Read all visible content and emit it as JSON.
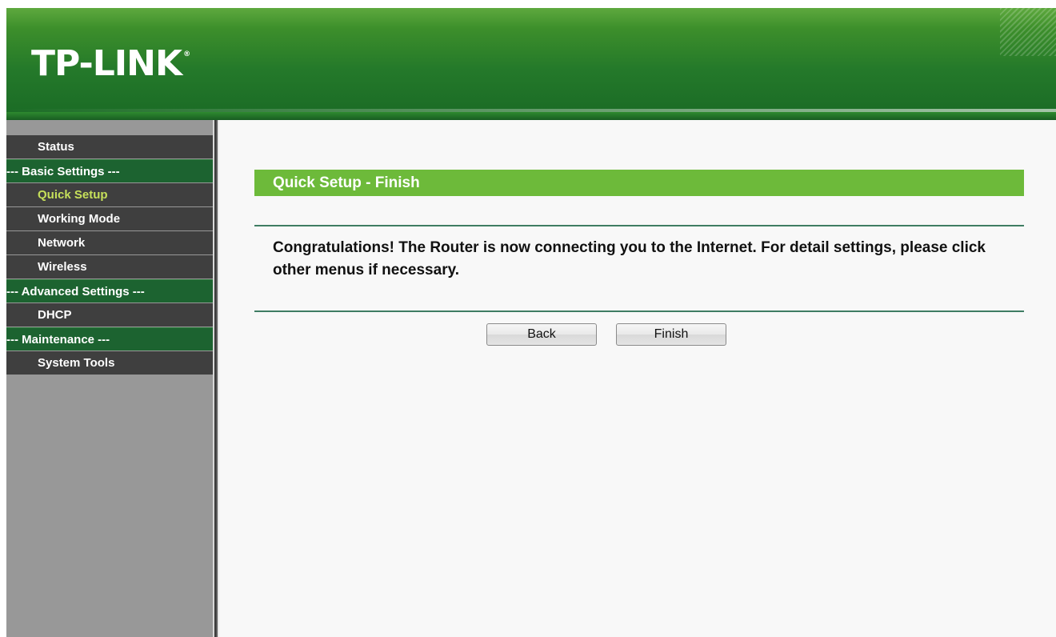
{
  "header": {
    "logo_text": "TP-LINK",
    "logo_mark": "®"
  },
  "sidebar": {
    "items": [
      {
        "label": "Status",
        "type": "item"
      },
      {
        "label": "--- Basic Settings ---",
        "type": "group"
      },
      {
        "label": "Quick Setup",
        "type": "item",
        "active": true
      },
      {
        "label": "Working Mode",
        "type": "item"
      },
      {
        "label": "Network",
        "type": "item"
      },
      {
        "label": "Wireless",
        "type": "item"
      },
      {
        "label": "--- Advanced Settings ---",
        "type": "group"
      },
      {
        "label": "DHCP",
        "type": "item"
      },
      {
        "label": "--- Maintenance ---",
        "type": "group"
      },
      {
        "label": "System Tools",
        "type": "item"
      }
    ]
  },
  "main": {
    "title": "Quick Setup - Finish",
    "message": "Congratulations! The Router is now connecting you to the Internet. For detail settings, please click other menus if necessary.",
    "back_label": "Back",
    "finish_label": "Finish"
  },
  "colors": {
    "brand_green": "#24792a",
    "title_bar_green": "#6dba3a",
    "active_menu_text": "#c6e05a",
    "group_header": "#1c6330"
  }
}
